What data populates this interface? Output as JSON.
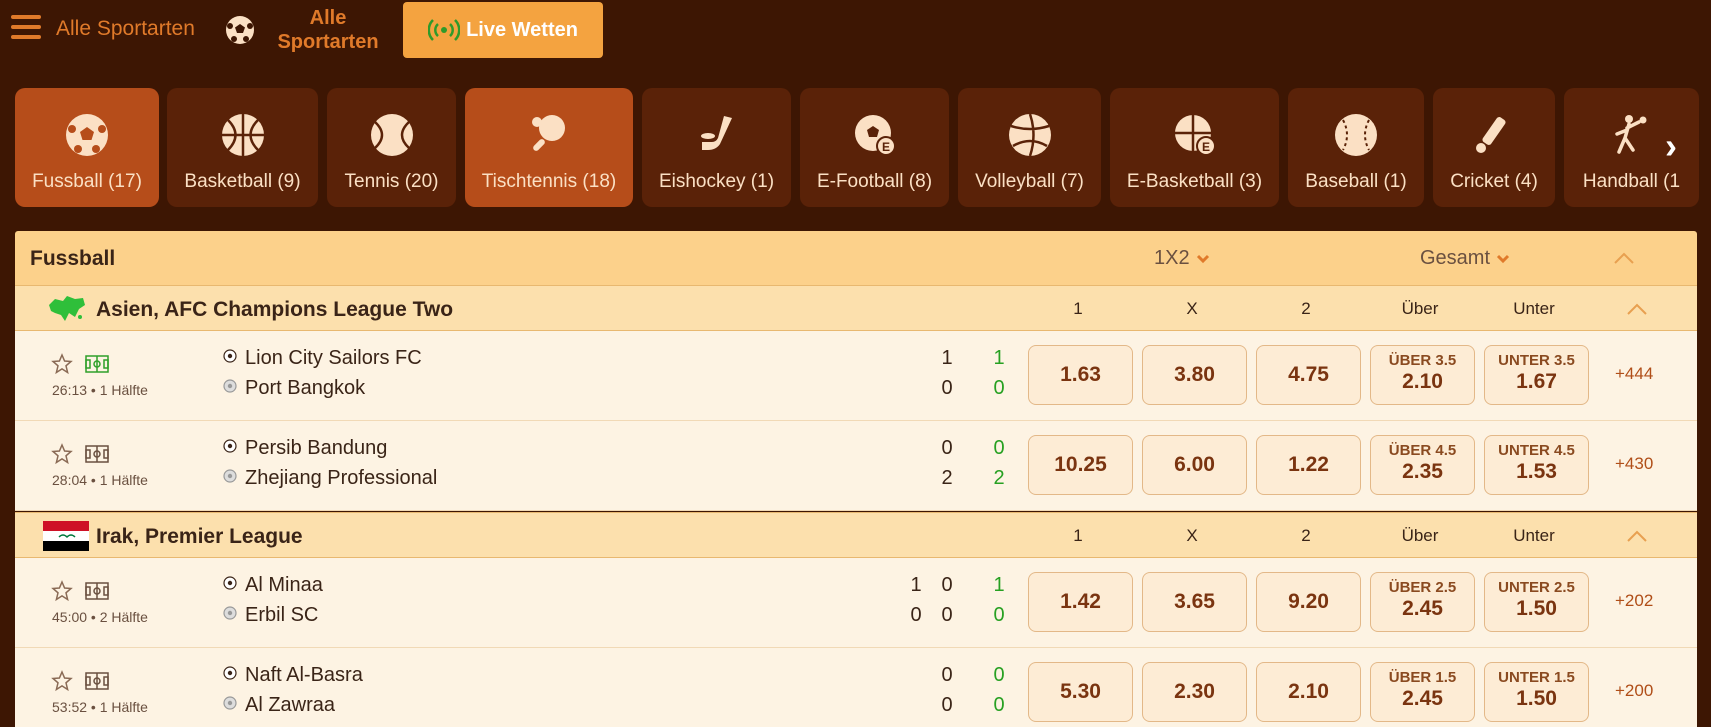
{
  "nav": {
    "all_sports": "Alle Sportarten",
    "all_sports_2": "Alle Sportarten",
    "live": "Live Wetten"
  },
  "sports": [
    {
      "label": "Fussball (17)",
      "icon": "soccer-ball-icon",
      "active": true
    },
    {
      "label": "Basketball (9)",
      "icon": "basketball-icon",
      "active": false
    },
    {
      "label": "Tennis (20)",
      "icon": "tennis-ball-icon",
      "active": false
    },
    {
      "label": "Tischtennis (18)",
      "icon": "table-tennis-icon",
      "active": true
    },
    {
      "label": "Eishockey (1)",
      "icon": "hockey-icon",
      "active": false
    },
    {
      "label": "E-Football (8)",
      "icon": "efootball-icon",
      "active": false
    },
    {
      "label": "Volleyball (7)",
      "icon": "volleyball-icon",
      "active": false
    },
    {
      "label": "E-Basketball (3)",
      "icon": "ebasketball-icon",
      "active": false
    },
    {
      "label": "Baseball (1)",
      "icon": "baseball-icon",
      "active": false
    },
    {
      "label": "Cricket (4)",
      "icon": "cricket-icon",
      "active": false
    },
    {
      "label": "Handball (1",
      "icon": "handball-icon",
      "active": false
    }
  ],
  "market": {
    "sport": "Fussball",
    "type": "1X2",
    "scope": "Gesamt"
  },
  "columns": [
    "1",
    "X",
    "2",
    "Über",
    "Unter"
  ],
  "leagues": [
    {
      "name": "Asien, AFC Champions League Two",
      "flag": "asia-map-icon",
      "matches": [
        {
          "time": "26:13 • 1 Hälfte",
          "home": "Lion City Sailors FC",
          "away": "Port Bangkok",
          "home_scores": [
            "",
            "1",
            "1"
          ],
          "away_scores": [
            "",
            "0",
            "0"
          ],
          "odds": [
            "1.63",
            "3.80",
            "4.75"
          ],
          "over_label": "ÜBER 3.5",
          "over": "2.10",
          "under_label": "UNTER 3.5",
          "under": "1.67",
          "more": "+444"
        },
        {
          "time": "28:04 • 1 Hälfte",
          "home": "Persib Bandung",
          "away": "Zhejiang Professional",
          "home_scores": [
            "",
            "0",
            "0"
          ],
          "away_scores": [
            "",
            "2",
            "2"
          ],
          "odds": [
            "10.25",
            "6.00",
            "1.22"
          ],
          "over_label": "ÜBER 4.5",
          "over": "2.35",
          "under_label": "UNTER 4.5",
          "under": "1.53",
          "more": "+430"
        }
      ]
    },
    {
      "name": "Irak, Premier League",
      "flag": "iraq-flag-icon",
      "matches": [
        {
          "time": "45:00 • 2 Hälfte",
          "home": "Al Minaa",
          "away": "Erbil SC",
          "home_scores": [
            "1",
            "0",
            "1"
          ],
          "away_scores": [
            "0",
            "0",
            "0"
          ],
          "odds": [
            "1.42",
            "3.65",
            "9.20"
          ],
          "over_label": "ÜBER 2.5",
          "over": "2.45",
          "under_label": "UNTER 2.5",
          "under": "1.50",
          "more": "+202"
        },
        {
          "time": "53:52 • 1 Hälfte",
          "home": "Naft Al-Basra",
          "away": "Al Zawraa",
          "home_scores": [
            "",
            "0",
            "0"
          ],
          "away_scores": [
            "",
            "0",
            "0"
          ],
          "odds": [
            "5.30",
            "2.30",
            "2.10"
          ],
          "over_label": "ÜBER 1.5",
          "over": "2.45",
          "under_label": "UNTER 1.5",
          "under": "1.50",
          "more": "+200"
        }
      ]
    }
  ]
}
